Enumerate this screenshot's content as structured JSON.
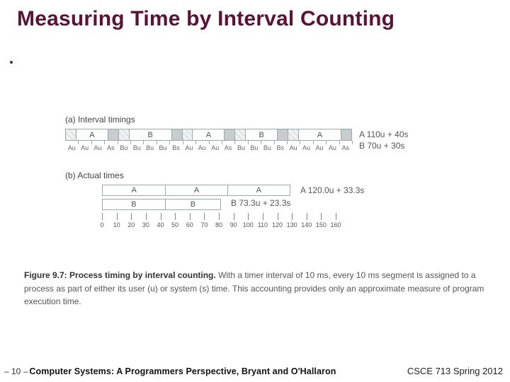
{
  "title": "Measuring Time by Interval Counting",
  "figure": {
    "sectionA": {
      "heading": "(a)  Interval timings",
      "timeline": [
        {
          "w": 10,
          "cls": "idle"
        },
        {
          "w": 30,
          "cls": "user",
          "label": "A"
        },
        {
          "w": 10,
          "cls": "sys"
        },
        {
          "w": 10,
          "cls": "idle"
        },
        {
          "w": 40,
          "cls": "user",
          "label": "B"
        },
        {
          "w": 10,
          "cls": "sys"
        },
        {
          "w": 10,
          "cls": "idle"
        },
        {
          "w": 30,
          "cls": "user",
          "label": "A"
        },
        {
          "w": 10,
          "cls": "sys"
        },
        {
          "w": 10,
          "cls": "idle"
        },
        {
          "w": 30,
          "cls": "user",
          "label": "B"
        },
        {
          "w": 10,
          "cls": "sys"
        },
        {
          "w": 10,
          "cls": "idle"
        },
        {
          "w": 40,
          "cls": "user",
          "label": "A"
        },
        {
          "w": 10,
          "cls": "sys"
        }
      ],
      "tick_labels": [
        "Au",
        "Au",
        "Au",
        "As",
        "Bu",
        "Bu",
        "Bu",
        "Bu",
        "Bs",
        "Au",
        "Au",
        "Au",
        "As",
        "Bu",
        "Bu",
        "Bu",
        "Bs",
        "Au",
        "Au",
        "Au",
        "Au",
        "As"
      ],
      "right_lines": [
        "A   110u + 40s",
        "B     70u + 30s"
      ]
    },
    "sectionB": {
      "heading": "(b)  Actual times",
      "barA": {
        "segments": [
          {
            "w": 90,
            "label": "A"
          },
          {
            "w": 88,
            "label": "A"
          },
          {
            "w": 88,
            "label": "A"
          }
        ],
        "right": "A     120.0u + 33.3s"
      },
      "barB": {
        "segments": [
          {
            "w": 90,
            "label": "B"
          },
          {
            "w": 78,
            "label": "B"
          }
        ],
        "right": "B       73.3u + 23.3s"
      },
      "axis_labels": [
        "0",
        "10",
        "20",
        "30",
        "40",
        "50",
        "60",
        "70",
        "80",
        "90",
        "100",
        "110",
        "120",
        "130",
        "140",
        "150",
        "160"
      ]
    }
  },
  "caption": {
    "lead": "Figure 9.7: Process timing by interval counting.",
    "rest": " With a timer interval of 10 ms, every 10 ms segment is assigned to a process as part of either its user (u) or system (s) time. This accounting provides only an approximate measure of program execution time."
  },
  "footer": {
    "page": "– 10 –",
    "center": "Computer Systems: A Programmers Perspective, Bryant and O'Hallaron",
    "right": "CSCE 713 Spring 2012"
  },
  "chart_data": [
    {
      "type": "table",
      "title": "Interval timings (10 ms slots attributed to process user/system time)",
      "categories": [
        "Au",
        "Au",
        "Au",
        "As",
        "Bu",
        "Bu",
        "Bu",
        "Bu",
        "Bs",
        "Au",
        "Au",
        "Au",
        "As",
        "Bu",
        "Bu",
        "Bu",
        "Bs",
        "Au",
        "Au",
        "Au",
        "Au",
        "As"
      ],
      "series": [
        {
          "name": "A (attributed)",
          "values": {
            "user_ms": 110,
            "system_ms": 40
          }
        },
        {
          "name": "B (attributed)",
          "values": {
            "user_ms": 70,
            "system_ms": 30
          }
        }
      ],
      "xlabel": "time slots (10 ms each)",
      "ylabel": ""
    },
    {
      "type": "bar",
      "title": "Actual times",
      "categories": [
        "A",
        "B"
      ],
      "series": [
        {
          "name": "user (u) ms",
          "values": [
            120.0,
            73.3
          ]
        },
        {
          "name": "system (s) ms",
          "values": [
            33.3,
            23.3
          ]
        }
      ],
      "xlabel": "time (ms)",
      "ylabel": "",
      "xlim": [
        0,
        160
      ]
    }
  ]
}
